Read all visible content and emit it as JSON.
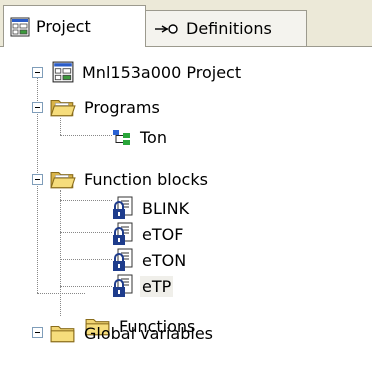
{
  "tabs": [
    {
      "label": "Project",
      "icon": "project-icon",
      "active": true
    },
    {
      "label": "Definitions",
      "icon": "definitions-icon",
      "active": false
    }
  ],
  "tree": {
    "root": {
      "label": "Mnl153a000 Project",
      "icon": "project-icon",
      "expanded": true
    },
    "programs": {
      "label": "Programs",
      "icon": "open-folder-icon",
      "expanded": true
    },
    "program_items": [
      {
        "label": "Ton",
        "icon": "program-icon"
      }
    ],
    "function_blocks": {
      "label": "Function blocks",
      "icon": "open-folder-icon",
      "expanded": true
    },
    "function_block_items": [
      {
        "label": "BLINK",
        "icon": "locked-block-icon"
      },
      {
        "label": "eTOF",
        "icon": "locked-block-icon"
      },
      {
        "label": "eTON",
        "icon": "locked-block-icon"
      },
      {
        "label": "eTP",
        "icon": "locked-block-icon",
        "selected": true
      }
    ],
    "functions": {
      "label": "Functions",
      "icon": "folder-icon"
    },
    "global_variables": {
      "label": "Global variables",
      "icon": "folder-icon",
      "expanded": true
    }
  },
  "colors": {
    "tab_background": "#ece9d8",
    "selection": "#f0efea",
    "folder": "#f2d675",
    "lock": "#1e3c8c"
  }
}
